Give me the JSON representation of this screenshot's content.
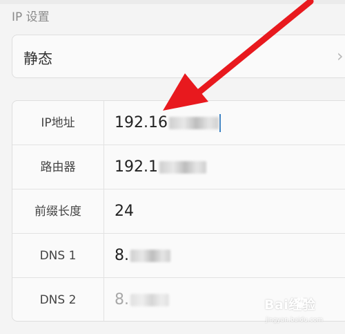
{
  "section": {
    "title": "IP 设置"
  },
  "mode": {
    "value": "静态",
    "icon": "chevron-right-icon"
  },
  "fields": [
    {
      "label": "IP地址",
      "value": "192.16"
    },
    {
      "label": "路由器",
      "value": "192.1"
    },
    {
      "label": "前缀长度",
      "value": "24"
    },
    {
      "label": "DNS 1",
      "value": "8."
    },
    {
      "label": "DNS 2",
      "value": "8."
    }
  ],
  "watermark": {
    "logo": "Bai经验",
    "url": "jingyan.baidu.com"
  },
  "colors": {
    "arrow": "#e8191e",
    "cursor": "#3b82c4",
    "placeholder": "#a8a8a8"
  }
}
